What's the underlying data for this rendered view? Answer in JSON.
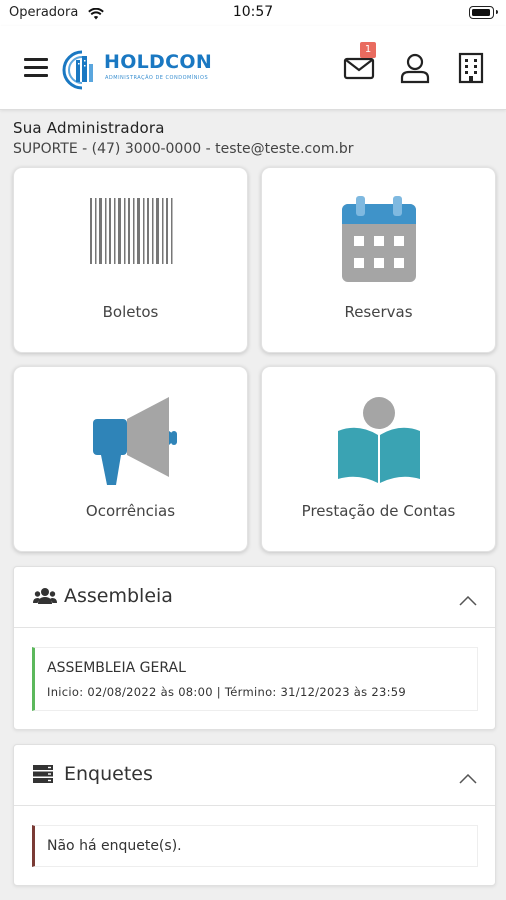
{
  "status_bar": {
    "carrier": "Operadora",
    "time": "10:57"
  },
  "header": {
    "brand_name": "HOLDCON",
    "brand_tagline": "ADMINISTRAÇÃO DE CONDOMÍNIOS",
    "mail_badge_count": "1",
    "colors": {
      "brand": "#1a78c2",
      "badge": "#e96b5f"
    }
  },
  "admin": {
    "title": "Sua Administradora",
    "contact": "SUPORTE - (47) 3000-0000 - teste@teste.com.br"
  },
  "tiles": [
    {
      "label": "Boletos",
      "icon": "barcode-icon"
    },
    {
      "label": "Reservas",
      "icon": "calendar-icon"
    },
    {
      "label": "Ocorrências",
      "icon": "megaphone-icon"
    },
    {
      "label": "Prestação de Contas",
      "icon": "reading-person-icon"
    }
  ],
  "assembleia": {
    "title": "Assembleia",
    "item_title": "ASSEMBLEIA GERAL",
    "item_dates": "Inicio: 02/08/2022 às 08:00 | Término: 31/12/2023 às 23:59",
    "accent_color": "#5cb85c"
  },
  "enquetes": {
    "title": "Enquetes",
    "empty_text": "Não há enquete(s).",
    "accent_color": "#7a3b35"
  }
}
